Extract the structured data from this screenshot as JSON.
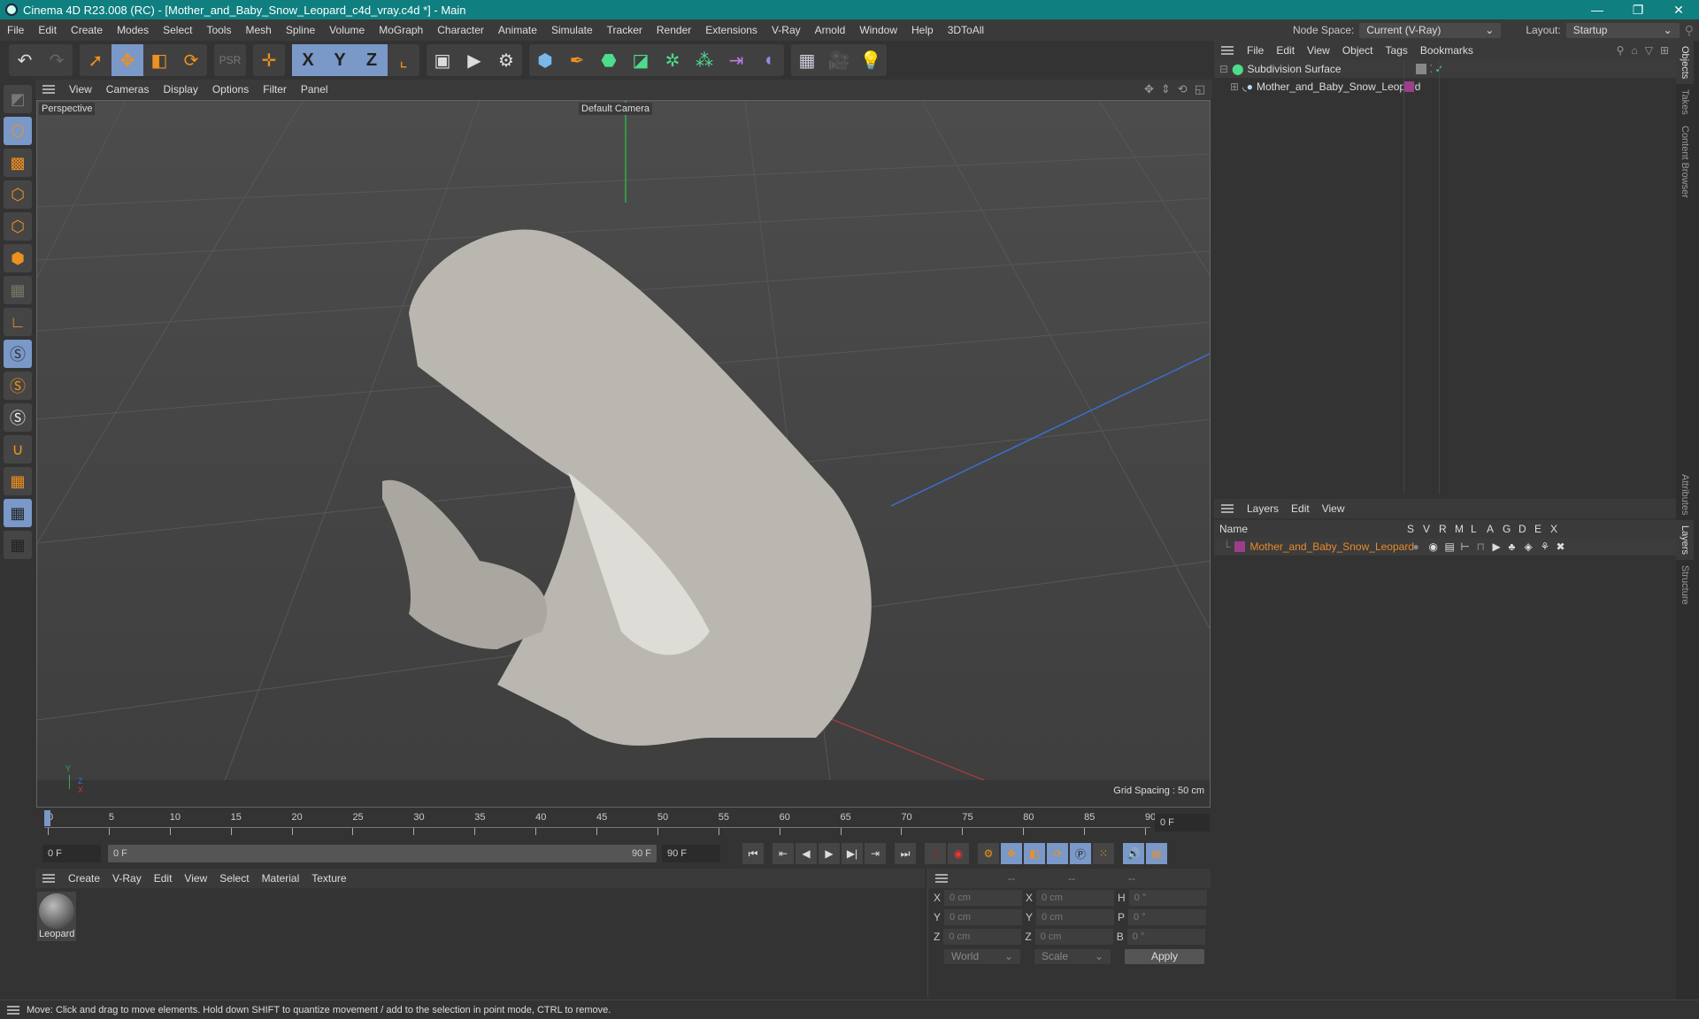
{
  "window": {
    "title": "Cinema 4D R23.008 (RC) - [Mother_and_Baby_Snow_Leopard_c4d_vray.c4d *] - Main",
    "controls": [
      "minimize",
      "restore",
      "close"
    ]
  },
  "menubar": {
    "items": [
      "File",
      "Edit",
      "Create",
      "Modes",
      "Select",
      "Tools",
      "Mesh",
      "Spline",
      "Volume",
      "MoGraph",
      "Character",
      "Animate",
      "Simulate",
      "Tracker",
      "Render",
      "Extensions",
      "V-Ray",
      "Arnold",
      "Window",
      "Help",
      "3DToAll"
    ],
    "node_space_label": "Node Space:",
    "node_space_value": "Current (V-Ray)",
    "layout_label": "Layout:",
    "layout_value": "Startup"
  },
  "toolbar": {
    "groups": [
      [
        "undo-icon",
        "redo-icon"
      ],
      [
        "select-icon",
        "move-icon",
        "scale-icon",
        "rotate-icon"
      ],
      [
        "psr-icon"
      ],
      [
        "move-axis-icon"
      ],
      [
        "x-axis-icon",
        "y-axis-icon",
        "z-axis-icon"
      ],
      [
        "coordinate-system-icon"
      ],
      [
        "render-view-icon",
        "render-picture-viewer-icon",
        "render-settings-icon"
      ],
      [
        "cube-icon",
        "pen-icon",
        "subdivision-icon",
        "extrude-icon",
        "mograph-cloner-icon",
        "cubes-icon",
        "symmetry-icon",
        "deformer-icon"
      ],
      [
        "floor-icon",
        "camera-icon",
        "light-icon"
      ]
    ],
    "axis_labels": [
      "X",
      "Y",
      "Z"
    ]
  },
  "left_toolbar": {
    "tools": [
      "model-mode",
      "texture-mode",
      "point-mode",
      "edge-mode",
      "polygon-mode",
      "uv-mode",
      "axis-mode",
      "solo-off",
      "solo",
      "solo-hierarchy",
      "snap",
      "workplane",
      "workplane-lock",
      "workplane-sync"
    ]
  },
  "viewport": {
    "menu": [
      "View",
      "Cameras",
      "Display",
      "Options",
      "Filter",
      "Panel"
    ],
    "view_name": "Perspective",
    "camera": "Default Camera",
    "grid_spacing": "Grid Spacing : 50 cm",
    "axis_labels": {
      "x": "X",
      "y": "Y",
      "z": "Z"
    }
  },
  "timeline": {
    "ticks": [
      "0",
      "5",
      "10",
      "15",
      "20",
      "25",
      "30",
      "35",
      "40",
      "45",
      "50",
      "55",
      "60",
      "65",
      "70",
      "75",
      "80",
      "85",
      "90"
    ],
    "current_frame": "0 F",
    "start_frame": "0 F",
    "range_start": "0 F",
    "range_end": "90 F",
    "end_frame": "90 F"
  },
  "materials": {
    "menu": [
      "Create",
      "V-Ray",
      "Edit",
      "View",
      "Select",
      "Material",
      "Texture"
    ],
    "items": [
      {
        "name": "Leopard"
      }
    ]
  },
  "coordinates": {
    "headers": [
      "--",
      "--",
      "--"
    ],
    "rows": [
      {
        "a_label": "X",
        "a_val": "0 cm",
        "b_label": "X",
        "b_val": "0 cm",
        "c_label": "H",
        "c_val": "0 °"
      },
      {
        "a_label": "Y",
        "a_val": "0 cm",
        "b_label": "Y",
        "b_val": "0 cm",
        "c_label": "P",
        "c_val": "0 °"
      },
      {
        "a_label": "Z",
        "a_val": "0 cm",
        "b_label": "Z",
        "b_val": "0 cm",
        "c_label": "B",
        "c_val": "0 °"
      }
    ],
    "mode": "World",
    "type": "Scale",
    "apply": "Apply"
  },
  "objects_panel": {
    "menu": [
      "File",
      "Edit",
      "View",
      "Object",
      "Tags",
      "Bookmarks"
    ],
    "items": [
      {
        "name": "Subdivision Surface",
        "level": 0
      },
      {
        "name": "Mother_and_Baby_Snow_Leopard",
        "level": 1
      }
    ]
  },
  "layers_panel": {
    "menu": [
      "Layers",
      "Edit",
      "View"
    ],
    "columns": [
      "Name",
      "S",
      "V",
      "R",
      "M",
      "L",
      "A",
      "G",
      "D",
      "E",
      "X"
    ],
    "items": [
      {
        "name": "Mother_and_Baby_Snow_Leopard",
        "color": "#9b3f8a"
      }
    ]
  },
  "side_tabs": {
    "top": [
      "Objects",
      "Takes",
      "Content Browser"
    ],
    "bottom": [
      "Attributes",
      "Layers",
      "Structure"
    ]
  },
  "status": "Move: Click and drag to move elements. Hold down SHIFT to quantize movement / add to the selection in point mode, CTRL to remove.",
  "colors": {
    "titlebar": "#0f7f80",
    "accent_orange": "#f0901e",
    "selected_blue": "#7a98c8",
    "layer_name": "#e98a2a"
  }
}
